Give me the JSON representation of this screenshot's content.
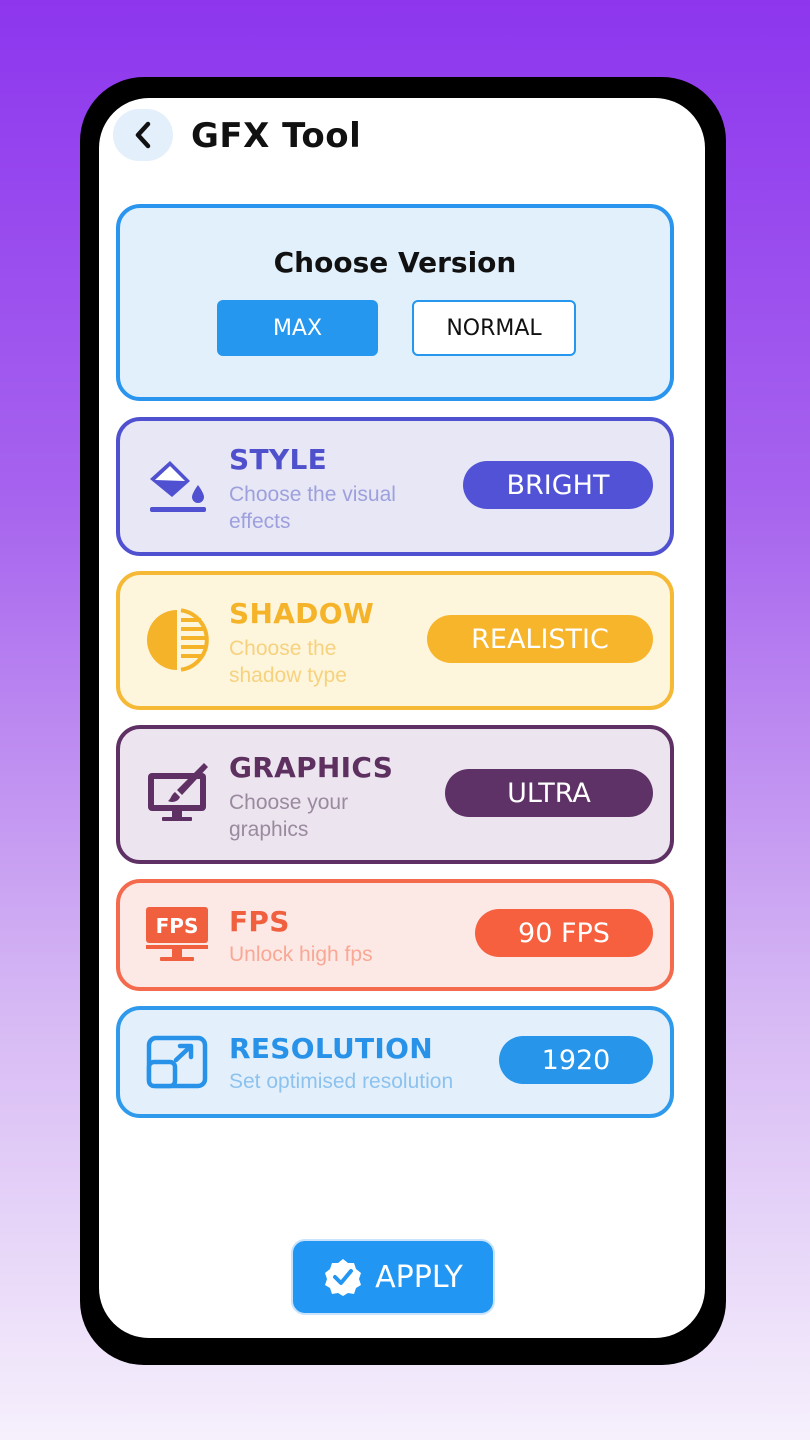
{
  "header": {
    "title": "GFX Tool",
    "back_icon": "chevron-left-icon"
  },
  "version": {
    "title": "Choose Version",
    "options": [
      "MAX",
      "NORMAL"
    ],
    "selected": "MAX"
  },
  "options": {
    "style": {
      "title": "STYLE",
      "desc": "Choose the visual effects",
      "value": "BRIGHT",
      "icon": "paint-bucket-icon",
      "color": "#5051d0"
    },
    "shadow": {
      "title": "SHADOW",
      "desc": "Choose the shadow type",
      "value": "REALISTIC",
      "icon": "half-circle-shadow-icon",
      "color": "#f5b935"
    },
    "graphics": {
      "title": "GRAPHICS",
      "desc": "Choose your graphics",
      "value": "ULTRA",
      "icon": "monitor-brush-icon",
      "color": "#5e3063"
    },
    "fps": {
      "title": "FPS",
      "desc": "Unlock high fps",
      "value": "90 FPS",
      "icon": "fps-monitor-icon",
      "color": "#f36b4c"
    },
    "resolution": {
      "title": "RESOLUTION",
      "desc": "Set optimised resolution",
      "value": "1920",
      "icon": "resize-icon",
      "color": "#2f9aec"
    }
  },
  "apply": {
    "label": "APPLY",
    "icon": "check-badge-icon"
  }
}
